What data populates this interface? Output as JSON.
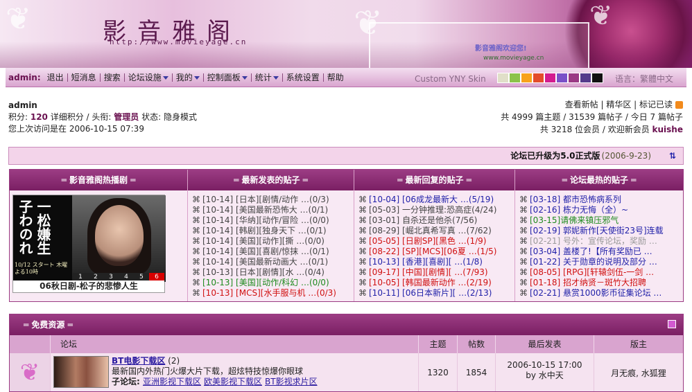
{
  "banner": {
    "title": "影音雅阁",
    "url": "http://www.movieyage.cn",
    "welcome": "影音雅阁欢迎您!",
    "site_url": "www.movieyage.cn"
  },
  "navbar": {
    "user": "admin:",
    "items": [
      "退出",
      "短消息",
      "搜索",
      "论坛设施",
      "我的",
      "控制面板",
      "统计",
      "系统设置",
      "帮助"
    ],
    "skin": "Custom YNY Skin",
    "lang": "语言：繁體中文"
  },
  "swatch_colors": [
    "#e0dfc8",
    "#8bc34a",
    "#f7a21b",
    "#e34c2b",
    "#d31b8f",
    "#7a50c8",
    "#9b3a85",
    "#553b8c",
    "#111111"
  ],
  "user": {
    "name": "admin",
    "line2_a": "积分: ",
    "points": "120",
    "line2_b": " 详细积分 / 头衔: ",
    "title": "管理员",
    "line2_c": " 状态: 隐身模式",
    "last_visit": "您上次访问是在 2006-10-15 07:39"
  },
  "stats": {
    "links": "查看新帖 | 精华区 | 标记已读",
    "line2_a": "共 4999 篇主题 / 31539 篇帖子 / 今日 7 篇帖子",
    "line3_a": "共 3218 位会员 / 欢迎新会员 ",
    "newest": "kuishe"
  },
  "announce": {
    "text": "论坛已升级为5.0正式版",
    "date": "(2006-9-23)"
  },
  "panel": {
    "headers": [
      "═ 影音雅阁热播剧 ═",
      "═ 最新发表的贴子 ═",
      "═ 最新回复的贴子 ═",
      "═ 论坛最热的贴子 ═"
    ],
    "movie": {
      "poster_text": "一松嫌生子わのれ",
      "timeslot": "10/12 スタート 木曜よる10時",
      "nums": [
        "1",
        "2",
        "3",
        "4",
        "5",
        "6"
      ],
      "caption": "06秋日剧-松子的悲惨人生"
    },
    "new_posts": [
      {
        "t": "[10-14] [日本][剧情/动作 …(0/3)",
        "c": "c-gray"
      },
      {
        "t": "[10-14] [美国最新恐怖大 …(0/1)",
        "c": "c-gray"
      },
      {
        "t": "[10-14] [华纳][动作/冒险 …(0/0)",
        "c": "c-gray"
      },
      {
        "t": "[10-14] [韩剧][独身天下 …(0/1)",
        "c": "c-gray"
      },
      {
        "t": "[10-14] [美国][动作][撕 …(0/0)",
        "c": "c-gray"
      },
      {
        "t": "[10-14] [美国][喜剧/惊抹 …(0/1)",
        "c": "c-gray"
      },
      {
        "t": "[10-14] [美国最新动画大 …(0/1)",
        "c": "c-gray"
      },
      {
        "t": "[10-13] [日本][剧情][水 …(0/4)",
        "c": "c-gray"
      },
      {
        "t": "[10-13] [美国][动作/科幻 …(0/0)",
        "c": "c-green"
      },
      {
        "t": "[10-13] [MCS][水手服与机 …(0/3)",
        "c": "c-red"
      }
    ],
    "replies": [
      {
        "t": "[10-04] [06成龙最新大 …(5/19)",
        "c": "c-blue"
      },
      {
        "t": "[05-03] 一分钟推理:恐高症(4/24)",
        "c": "c-gray"
      },
      {
        "t": "[03-01] 自杀还是他杀(7/56)",
        "c": "c-gray"
      },
      {
        "t": "[08-29] [崛北真希写真 …(7/62)",
        "c": "c-gray"
      },
      {
        "t": "[05-05] [日剧SP][黑色 …(1/9)",
        "c": "c-red"
      },
      {
        "t": "[08-22] [SP][MCS][06夏 …(1/5)",
        "c": "c-red"
      },
      {
        "t": "[10-13] [香港][喜剧][ …(1/8)",
        "c": "c-blue"
      },
      {
        "t": "[09-17] [中国][剧情][ …(7/93)",
        "c": "c-red"
      },
      {
        "t": "[10-05] [韩国最新动作 …(2/19)",
        "c": "c-red"
      },
      {
        "t": "[10-11] [06日本新片][ …(2/13)",
        "c": "c-blue"
      }
    ],
    "hot": [
      {
        "t": "[03-18] 都市恐怖病系列",
        "c": "c-blue"
      },
      {
        "t": "[02-16] 栋力无悔（全）~",
        "c": "c-blue"
      },
      {
        "t": "[03-15]请佛来镇压邪气",
        "c": "c-green"
      },
      {
        "t": "[02-19] 郭妮新作[天使街23号]连载",
        "c": "c-blue"
      },
      {
        "t": "[02-21] 号外：宣传论坛，奖励 …",
        "c": "c-light"
      },
      {
        "t": "[03-04] 盖楼了!【所有奖励已 …",
        "c": "c-blue"
      },
      {
        "t": "[01-22] 关于勋章的说明及部分 …",
        "c": "c-blue"
      },
      {
        "t": "[08-05] [RPG][轩辕剑伍-一剑 …",
        "c": "c-red"
      },
      {
        "t": "[01-18] 招才纳贤－斑竹大招聘",
        "c": "c-red"
      },
      {
        "t": "[02-21] 悬赏1000影币征集论坛 …",
        "c": "c-blue"
      }
    ]
  },
  "forum": {
    "title": "═ 免费资源 ═",
    "headers": [
      "论坛",
      "主题",
      "帖数",
      "最后发表",
      "版主"
    ],
    "row": {
      "name": "BT电影下载区",
      "count": "(2)",
      "desc": "最新国内外热门火爆大片下载，超炫特技惊爆你眼球",
      "sub_label": "子论坛: ",
      "subs": [
        "亚洲影视下载区",
        "欧美影视下载区",
        "BT影视求片区"
      ],
      "topics": "1320",
      "posts": "1854",
      "last_date": "2006-10-15 17:00",
      "last_by": "by 水中天",
      "mods": "月无痕, 水狐狸"
    }
  }
}
